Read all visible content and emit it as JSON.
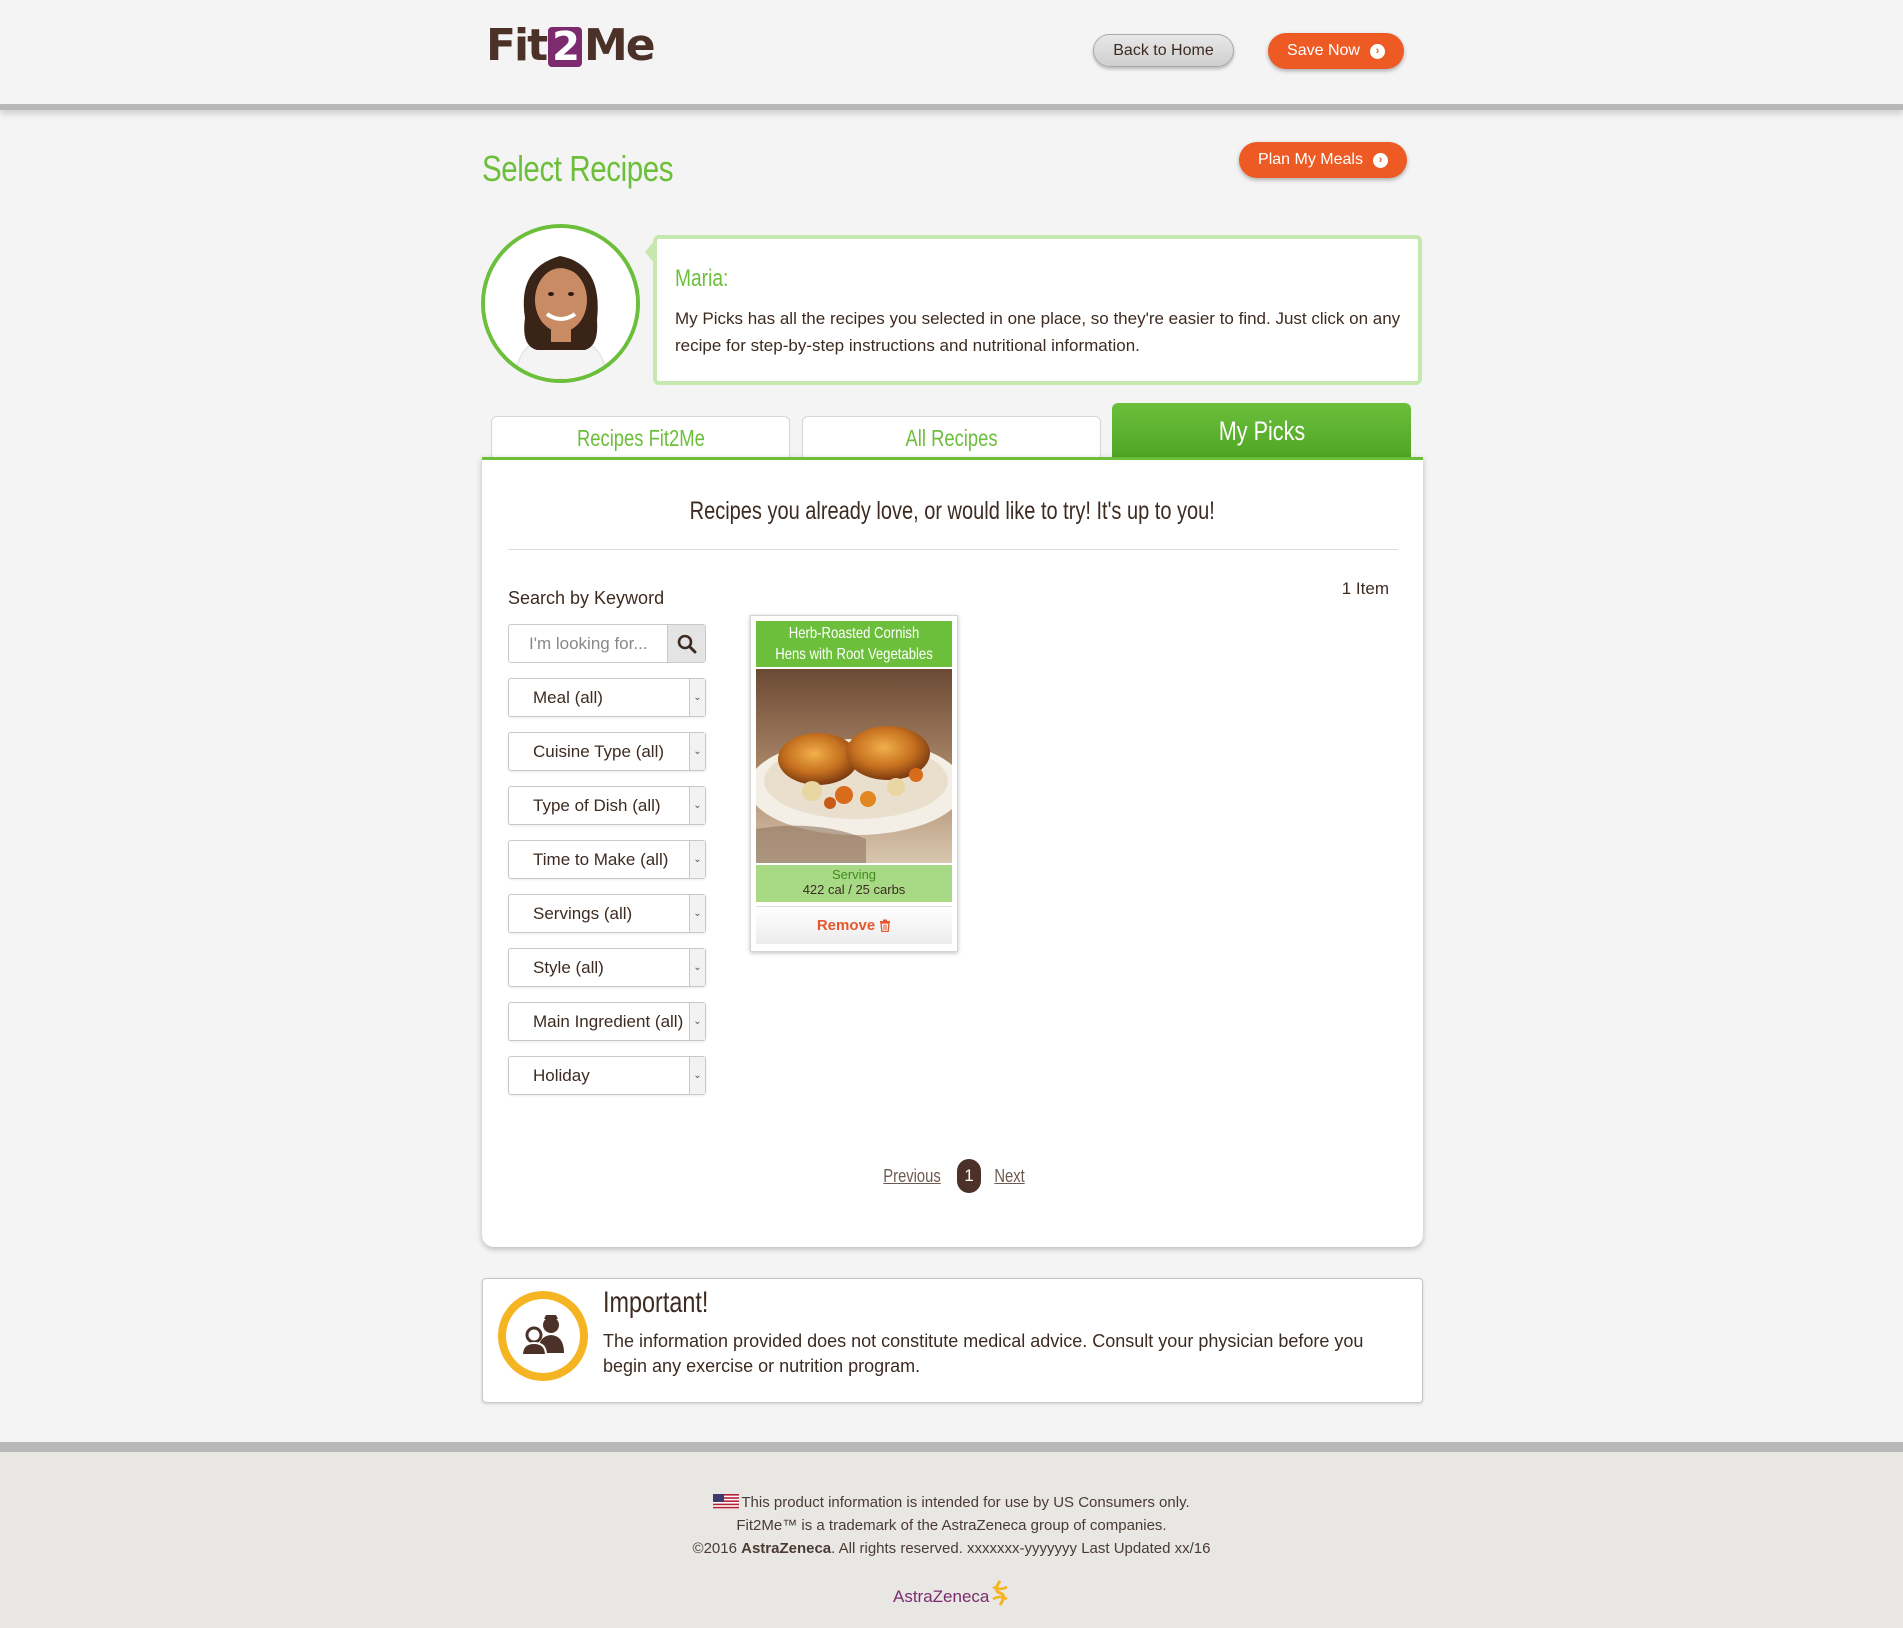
{
  "header": {
    "logo_left": "Fit",
    "logo_two": "2",
    "logo_right": "Me",
    "back_home_label": "Back to Home",
    "save_now_label": "Save Now"
  },
  "page": {
    "title": "Select Recipes",
    "plan_meals_label": "Plan My Meals"
  },
  "coach": {
    "name": "Maria:",
    "message": "My Picks has all the recipes you selected in one place, so they're easier to find. Just click on any recipe for step-by-step instructions and nutritional information."
  },
  "tabs": [
    {
      "label": "Recipes Fit2Me",
      "active": false
    },
    {
      "label": "All Recipes",
      "active": false
    },
    {
      "label": "My Picks",
      "active": true
    }
  ],
  "panel": {
    "heading": "Recipes you already love, or would like to try! It's up to you!",
    "item_count": "1 Item"
  },
  "search": {
    "label": "Search by Keyword",
    "placeholder": "I'm looking for..."
  },
  "filters": [
    "Meal (all)",
    "Cuisine Type (all)",
    "Type of Dish (all)",
    "Time to Make (all)",
    "Servings (all)",
    "Style (all)",
    "Main Ingredient (all)",
    "Holiday"
  ],
  "recipe": {
    "title": "Herb-Roasted Cornish Hens with Root Vegetables",
    "serving_label": "Serving",
    "nutrition": "422 cal / 25 carbs",
    "remove_label": "Remove"
  },
  "pager": {
    "previous": "Previous",
    "current": "1",
    "next": "Next"
  },
  "important": {
    "title": "Important!",
    "text": "The information provided does not constitute medical advice. Consult your physician before you begin any exercise or nutrition program."
  },
  "footer": {
    "line1": "This product information is intended for use by US Consumers only.",
    "line2": "Fit2Me™ is a trademark of the AstraZeneca group of companies.",
    "line3_prefix": "©2016 ",
    "line3_company": "AstraZeneca",
    "line3_suffix": ". All rights reserved. xxxxxxx-yyyyyyy Last Updated xx/16",
    "brand": "AstraZeneca"
  },
  "colors": {
    "green": "#6cbf3b",
    "orange": "#ee5a24",
    "brown": "#3d2b22",
    "purple": "#7b2b6e",
    "yellow": "#f5b422"
  },
  "icons": [
    "arrow-right-circle-icon",
    "search-icon",
    "trash-icon",
    "nurse-doctor-icon",
    "us-flag-icon",
    "astrazeneca-logo-icon"
  ]
}
